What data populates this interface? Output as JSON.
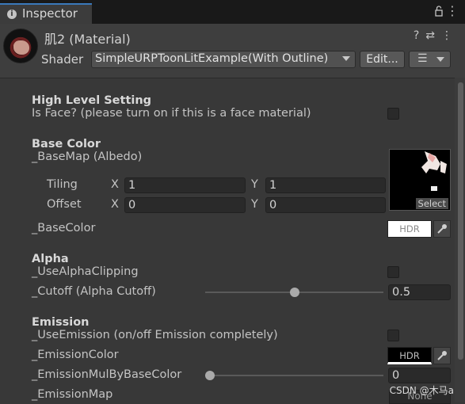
{
  "tab": {
    "title": "Inspector",
    "info_glyph": "i"
  },
  "header": {
    "material_name": "肌2 (Material)",
    "shader_label": "Shader",
    "shader_value": "SimpleURPToonLitExample(With Outline)",
    "edit_label": "Edit...",
    "icons": [
      "help-icon",
      "preset-icon",
      "more-icon"
    ]
  },
  "high_level": {
    "title": "High Level Setting",
    "is_face_label": "Is Face? (please turn on if this is a face material)",
    "is_face_checked": false
  },
  "base_color": {
    "title": "Base Color",
    "basemap_label": "_BaseMap (Albedo)",
    "tiling_label": "Tiling",
    "offset_label": "Offset",
    "x_axis": "X",
    "y_axis": "Y",
    "tiling_x": "1",
    "tiling_y": "1",
    "offset_x": "0",
    "offset_y": "0",
    "texture_select": "Select",
    "basecolor_label": "_BaseColor",
    "basecolor_hdr": "HDR",
    "basecolor_hex": "#ffffff"
  },
  "alpha": {
    "title": "Alpha",
    "use_clipping_label": "_UseAlphaClipping",
    "use_clipping_checked": false,
    "cutoff_label": "_Cutoff (Alpha Cutoff)",
    "cutoff_value": "0.5",
    "cutoff_fraction": 0.5
  },
  "emission": {
    "title": "Emission",
    "use_emission_label": "_UseEmission (on/off Emission completely)",
    "use_emission_checked": false,
    "color_label": "_EmissionColor",
    "color_hdr": "HDR",
    "color_hex": "#000000",
    "mul_label": "_EmissionMulByBaseColor",
    "mul_value": "0",
    "mul_fraction": 0,
    "map_label": "_EmissionMap",
    "map_value": "None"
  },
  "watermark": "CSDN @木马a"
}
